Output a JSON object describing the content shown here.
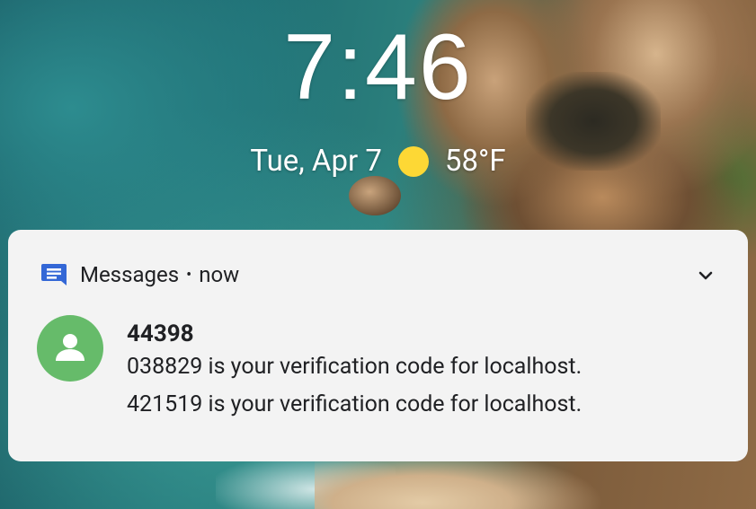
{
  "lockscreen": {
    "time": "7:46",
    "date": "Tue, Apr 7",
    "temperature": "58°F",
    "weather_icon": "sun-icon"
  },
  "notification": {
    "app_name": "Messages",
    "separator": "•",
    "timestamp": "now",
    "app_icon": "messages-app-icon",
    "sender": "44398",
    "messages": [
      "038829 is your verification code for localhost.",
      "421519 is your verification code for localhost."
    ],
    "colors": {
      "app_icon": "#3367d6",
      "avatar": "#66bb6a",
      "sun": "#fdd835"
    }
  }
}
